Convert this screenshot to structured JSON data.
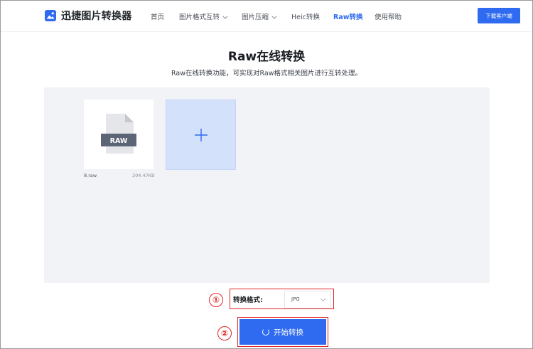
{
  "header": {
    "logo_text": "迅捷图片转换器",
    "nav": [
      {
        "label": "首页",
        "dropdown": false,
        "active": false
      },
      {
        "label": "图片格式互转",
        "dropdown": true,
        "active": false
      },
      {
        "label": "图片压缩",
        "dropdown": true,
        "active": false
      },
      {
        "label": "Heic转换",
        "dropdown": false,
        "active": false
      },
      {
        "label": "Raw转换",
        "dropdown": false,
        "active": true
      },
      {
        "label": "使用帮助",
        "dropdown": false,
        "active": false
      }
    ],
    "download_label": "下载客户端"
  },
  "main": {
    "title": "Raw在线转换",
    "subtitle": "Raw在线转换功能，可实现对Raw格式相关图片进行互转处理。"
  },
  "upload": {
    "files": [
      {
        "name": "8.raw",
        "size": "204.47KB",
        "badge": "RAW"
      }
    ],
    "add_icon": "plus-icon"
  },
  "format": {
    "step_number": "①",
    "label": "转换格式:",
    "selected": "JPG"
  },
  "start": {
    "step_number": "②",
    "label": "开始转换"
  },
  "colors": {
    "accent": "#2e6bf0",
    "annotation": "#e02424",
    "upload_bg": "#f2f3f6",
    "add_tile_bg": "#d3e1fb"
  }
}
